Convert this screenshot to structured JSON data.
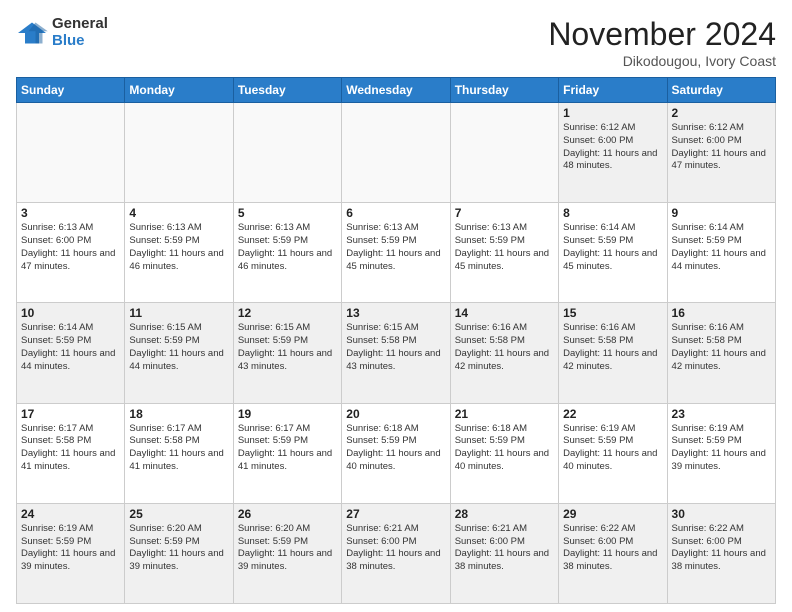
{
  "logo": {
    "general": "General",
    "blue": "Blue"
  },
  "title": "November 2024",
  "location": "Dikodougou, Ivory Coast",
  "days_of_week": [
    "Sunday",
    "Monday",
    "Tuesday",
    "Wednesday",
    "Thursday",
    "Friday",
    "Saturday"
  ],
  "weeks": [
    [
      {
        "day": "",
        "info": ""
      },
      {
        "day": "",
        "info": ""
      },
      {
        "day": "",
        "info": ""
      },
      {
        "day": "",
        "info": ""
      },
      {
        "day": "",
        "info": ""
      },
      {
        "day": "1",
        "info": "Sunrise: 6:12 AM\nSunset: 6:00 PM\nDaylight: 11 hours\nand 48 minutes."
      },
      {
        "day": "2",
        "info": "Sunrise: 6:12 AM\nSunset: 6:00 PM\nDaylight: 11 hours\nand 47 minutes."
      }
    ],
    [
      {
        "day": "3",
        "info": "Sunrise: 6:13 AM\nSunset: 6:00 PM\nDaylight: 11 hours\nand 47 minutes."
      },
      {
        "day": "4",
        "info": "Sunrise: 6:13 AM\nSunset: 5:59 PM\nDaylight: 11 hours\nand 46 minutes."
      },
      {
        "day": "5",
        "info": "Sunrise: 6:13 AM\nSunset: 5:59 PM\nDaylight: 11 hours\nand 46 minutes."
      },
      {
        "day": "6",
        "info": "Sunrise: 6:13 AM\nSunset: 5:59 PM\nDaylight: 11 hours\nand 45 minutes."
      },
      {
        "day": "7",
        "info": "Sunrise: 6:13 AM\nSunset: 5:59 PM\nDaylight: 11 hours\nand 45 minutes."
      },
      {
        "day": "8",
        "info": "Sunrise: 6:14 AM\nSunset: 5:59 PM\nDaylight: 11 hours\nand 45 minutes."
      },
      {
        "day": "9",
        "info": "Sunrise: 6:14 AM\nSunset: 5:59 PM\nDaylight: 11 hours\nand 44 minutes."
      }
    ],
    [
      {
        "day": "10",
        "info": "Sunrise: 6:14 AM\nSunset: 5:59 PM\nDaylight: 11 hours\nand 44 minutes."
      },
      {
        "day": "11",
        "info": "Sunrise: 6:15 AM\nSunset: 5:59 PM\nDaylight: 11 hours\nand 44 minutes."
      },
      {
        "day": "12",
        "info": "Sunrise: 6:15 AM\nSunset: 5:59 PM\nDaylight: 11 hours\nand 43 minutes."
      },
      {
        "day": "13",
        "info": "Sunrise: 6:15 AM\nSunset: 5:58 PM\nDaylight: 11 hours\nand 43 minutes."
      },
      {
        "day": "14",
        "info": "Sunrise: 6:16 AM\nSunset: 5:58 PM\nDaylight: 11 hours\nand 42 minutes."
      },
      {
        "day": "15",
        "info": "Sunrise: 6:16 AM\nSunset: 5:58 PM\nDaylight: 11 hours\nand 42 minutes."
      },
      {
        "day": "16",
        "info": "Sunrise: 6:16 AM\nSunset: 5:58 PM\nDaylight: 11 hours\nand 42 minutes."
      }
    ],
    [
      {
        "day": "17",
        "info": "Sunrise: 6:17 AM\nSunset: 5:58 PM\nDaylight: 11 hours\nand 41 minutes."
      },
      {
        "day": "18",
        "info": "Sunrise: 6:17 AM\nSunset: 5:58 PM\nDaylight: 11 hours\nand 41 minutes."
      },
      {
        "day": "19",
        "info": "Sunrise: 6:17 AM\nSunset: 5:59 PM\nDaylight: 11 hours\nand 41 minutes."
      },
      {
        "day": "20",
        "info": "Sunrise: 6:18 AM\nSunset: 5:59 PM\nDaylight: 11 hours\nand 40 minutes."
      },
      {
        "day": "21",
        "info": "Sunrise: 6:18 AM\nSunset: 5:59 PM\nDaylight: 11 hours\nand 40 minutes."
      },
      {
        "day": "22",
        "info": "Sunrise: 6:19 AM\nSunset: 5:59 PM\nDaylight: 11 hours\nand 40 minutes."
      },
      {
        "day": "23",
        "info": "Sunrise: 6:19 AM\nSunset: 5:59 PM\nDaylight: 11 hours\nand 39 minutes."
      }
    ],
    [
      {
        "day": "24",
        "info": "Sunrise: 6:19 AM\nSunset: 5:59 PM\nDaylight: 11 hours\nand 39 minutes."
      },
      {
        "day": "25",
        "info": "Sunrise: 6:20 AM\nSunset: 5:59 PM\nDaylight: 11 hours\nand 39 minutes."
      },
      {
        "day": "26",
        "info": "Sunrise: 6:20 AM\nSunset: 5:59 PM\nDaylight: 11 hours\nand 39 minutes."
      },
      {
        "day": "27",
        "info": "Sunrise: 6:21 AM\nSunset: 6:00 PM\nDaylight: 11 hours\nand 38 minutes."
      },
      {
        "day": "28",
        "info": "Sunrise: 6:21 AM\nSunset: 6:00 PM\nDaylight: 11 hours\nand 38 minutes."
      },
      {
        "day": "29",
        "info": "Sunrise: 6:22 AM\nSunset: 6:00 PM\nDaylight: 11 hours\nand 38 minutes."
      },
      {
        "day": "30",
        "info": "Sunrise: 6:22 AM\nSunset: 6:00 PM\nDaylight: 11 hours\nand 38 minutes."
      }
    ]
  ]
}
